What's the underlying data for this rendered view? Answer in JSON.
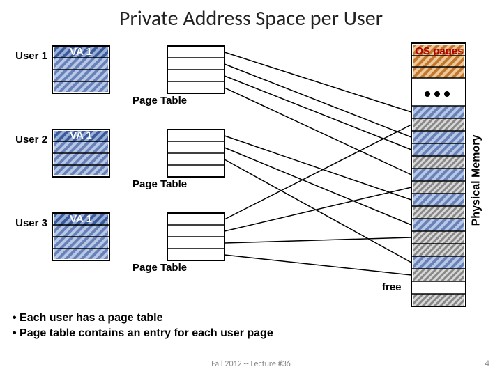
{
  "title": "Private Address Space per User",
  "users": [
    {
      "label": "User 1",
      "va": "VA 1",
      "pt": "Page Table"
    },
    {
      "label": "User 2",
      "va": "VA 1",
      "pt": "Page Table"
    },
    {
      "label": "User 3",
      "va": "VA 1",
      "pt": "Page Table"
    }
  ],
  "os_label": "OS pages",
  "phys_label": "Physical Memory",
  "free_label": "free",
  "bullets": [
    "Each user has a page table",
    "Page table contains an entry for each user page"
  ],
  "footer": "Fall 2012 -- Lecture #36",
  "pagenum": "4",
  "colors": {
    "os_text": "#b00000",
    "user_blue": "#5a7dc0",
    "user_blue_dk": "#3a5a9a",
    "phys_blue": "#9ab0d8",
    "phys_blue_dk": "#5d78b0",
    "os_orange": "#e0a56a",
    "os_orange_dk": "#b86a24",
    "hatched_base": "#c0c0c0"
  }
}
